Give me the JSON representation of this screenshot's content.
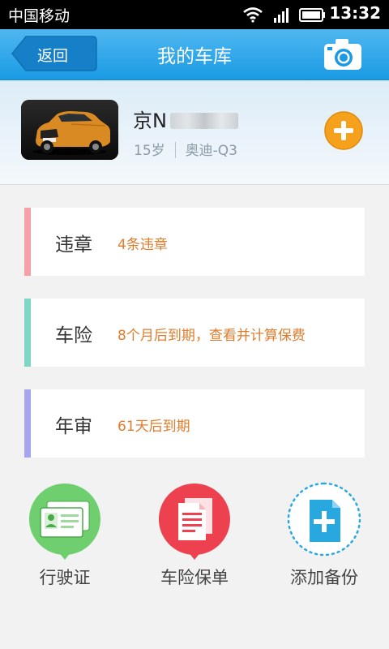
{
  "status_bar": {
    "carrier": "中国移动",
    "time": "13:32"
  },
  "header": {
    "back_label": "返回",
    "title": "我的车库"
  },
  "car": {
    "plate_prefix": "京N",
    "age": "15岁",
    "model": "奥迪-Q3"
  },
  "cards": [
    {
      "label": "违章",
      "info": "4条违章",
      "accent": "#f6a0a8"
    },
    {
      "label": "车险",
      "info": "8个月后到期，查看并计算保费",
      "accent": "#7fd6c2"
    },
    {
      "label": "年审",
      "info": "61天后到期",
      "accent": "#a7a5ee"
    }
  ],
  "actions": [
    {
      "label": "行驶证",
      "color": "#6fcf6f"
    },
    {
      "label": "车险保单",
      "color": "#ee4150"
    },
    {
      "label": "添加备份",
      "color": "#29a8e0"
    }
  ],
  "colors": {
    "title_bar": "#2aa5ea",
    "info_text": "#e07c2c",
    "add_button": "#f5a11c"
  }
}
